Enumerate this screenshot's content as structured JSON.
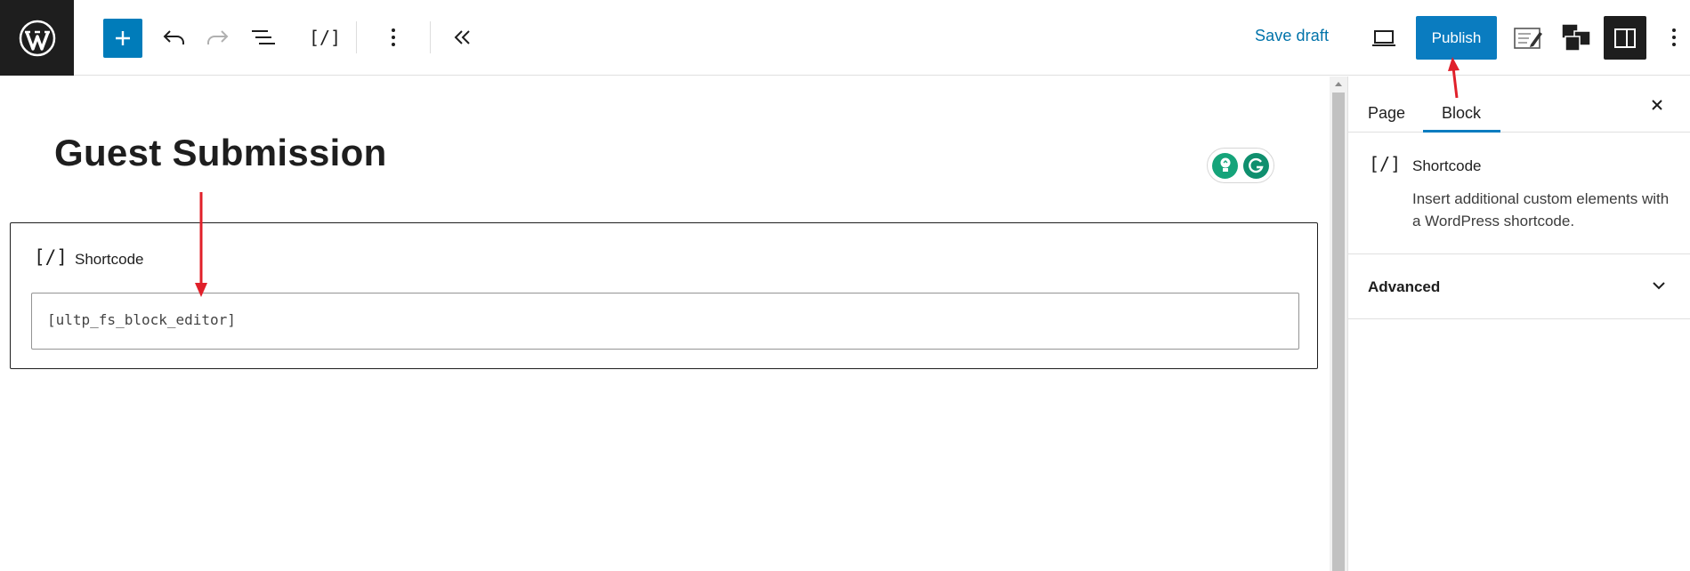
{
  "topbar": {
    "logo_icon": "wordpress-logo-icon",
    "inserter_icon": "plus-icon",
    "undo_icon": "undo-icon",
    "redo_icon": "redo-icon",
    "list_view_icon": "list-view-icon",
    "block_icon_glyph": "[/]",
    "options_icon": "vertical-ellipsis-icon",
    "collapse_icon": "double-chevron-left-icon",
    "save_draft_label": "Save draft",
    "preview_icon": "desktop-preview-icon",
    "publish_label": "Publish",
    "notes_icon": "edit-notes-icon",
    "blocks_icon": "block-switcher-icon",
    "settings_icon": "sidebar-toggle-icon",
    "more_icon": "vertical-ellipsis-icon"
  },
  "canvas": {
    "page_title": "Guest Submission",
    "grammarly_icons": [
      "lightbulb-icon",
      "grammarly-icon"
    ],
    "block": {
      "icon_glyph": "[/]",
      "label": "Shortcode",
      "input_value": "[ultp_fs_block_editor]"
    }
  },
  "sidebar": {
    "tabs": [
      {
        "label": "Page",
        "active": false
      },
      {
        "label": "Block",
        "active": true
      }
    ],
    "close_icon": "close-icon",
    "block_card": {
      "icon_glyph": "[/]",
      "title": "Shortcode",
      "description": "Insert additional custom elements with a WordPress shortcode."
    },
    "advanced_label": "Advanced"
  },
  "colors": {
    "accent": "#007cba",
    "annotation": "#e0202a",
    "dark": "#1e1e1e"
  }
}
